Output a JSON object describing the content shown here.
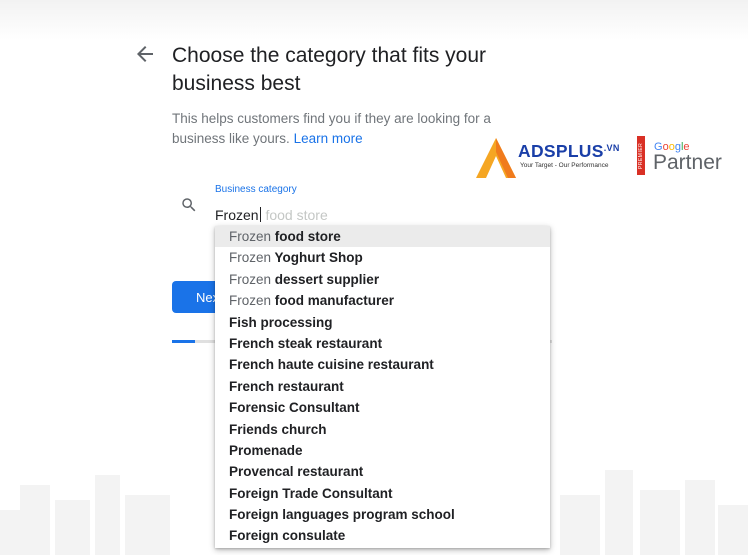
{
  "page": {
    "heading": "Choose the category that fits your business best",
    "subtext": "This helps customers find you if they are looking for a business like yours.",
    "learn_more": "Learn more"
  },
  "search": {
    "label": "Business category",
    "typed": "Frozen",
    "autocomplete_hint": " food store"
  },
  "next_button": {
    "label": "Next"
  },
  "progress": {
    "fraction": 0.06
  },
  "suggestions": [
    {
      "match": "Frozen",
      "rest": " food store",
      "highlighted": true
    },
    {
      "match": "Frozen",
      "rest": " Yoghurt Shop"
    },
    {
      "match": "Frozen",
      "rest": " dessert supplier"
    },
    {
      "match": "Frozen",
      "rest": " food manufacturer"
    },
    {
      "match": "",
      "rest": "Fish processing"
    },
    {
      "match": "",
      "rest": "French steak restaurant"
    },
    {
      "match": "",
      "rest": "French haute cuisine restaurant"
    },
    {
      "match": "",
      "rest": "French restaurant"
    },
    {
      "match": "",
      "rest": "Forensic Consultant"
    },
    {
      "match": "",
      "rest": "Friends church"
    },
    {
      "match": "",
      "rest": "Promenade"
    },
    {
      "match": "",
      "rest": "Provencal restaurant"
    },
    {
      "match": "",
      "rest": "Foreign Trade Consultant"
    },
    {
      "match": "",
      "rest": "Foreign languages program school"
    },
    {
      "match": "",
      "rest": "Foreign consulate"
    }
  ],
  "watermark": {
    "brand": "ADSPLUS",
    "brand_tld": ".VN",
    "tagline": "Your Target - Our Performance",
    "badge": "PREMIER",
    "google": "Google",
    "partner": "Partner"
  },
  "colors": {
    "accent": "#1a73e8",
    "heading_text": "#202124",
    "muted_text": "#70757a",
    "highlight_row": "#ebebeb"
  },
  "icons": {
    "back": "arrow-left",
    "search": "magnifier"
  }
}
